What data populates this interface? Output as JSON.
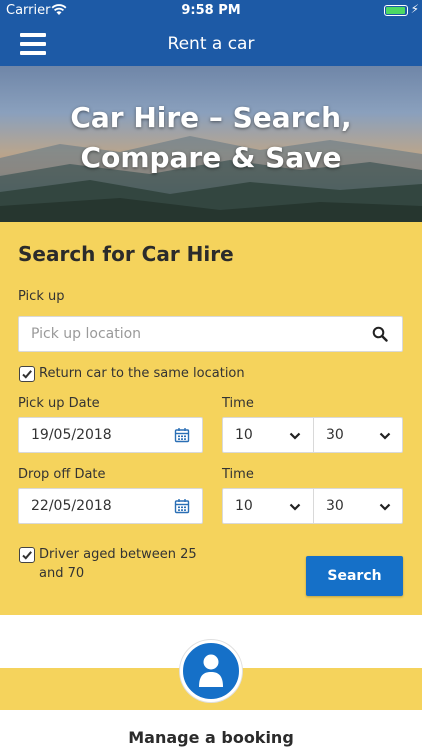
{
  "status_bar": {
    "carrier": "Carrier",
    "time": "9:58 PM",
    "battery_level": 0.95
  },
  "nav": {
    "title": "Rent a car"
  },
  "hero": {
    "title": "Car Hire – Search, Compare & Save"
  },
  "search": {
    "title": "Search for Car Hire",
    "pickup_label": "Pick up",
    "pickup_placeholder": "Pick up location",
    "return_same_location_label": "Return car to the same location",
    "return_same_location_checked": true,
    "pickup_date_label": "Pick up Date",
    "pickup_date": "19/05/2018",
    "pickup_time_label": "Time",
    "pickup_hour": "10",
    "pickup_minute": "30",
    "dropoff_date_label": "Drop off Date",
    "dropoff_date": "22/05/2018",
    "dropoff_time_label": "Time",
    "dropoff_hour": "10",
    "dropoff_minute": "30",
    "driver_age_label": "Driver aged between 25 and 70",
    "driver_age_checked": true,
    "search_button": "Search"
  },
  "manage": {
    "title": "Manage a booking"
  },
  "colors": {
    "brand_blue": "#1d5aa6",
    "button_blue": "#1570c8",
    "panel_yellow": "#f5d35c"
  },
  "icons": [
    "menu-icon",
    "wifi-icon",
    "battery-icon",
    "search-icon",
    "calendar-icon",
    "chevron-down-icon",
    "checkmark-icon",
    "user-icon"
  ]
}
